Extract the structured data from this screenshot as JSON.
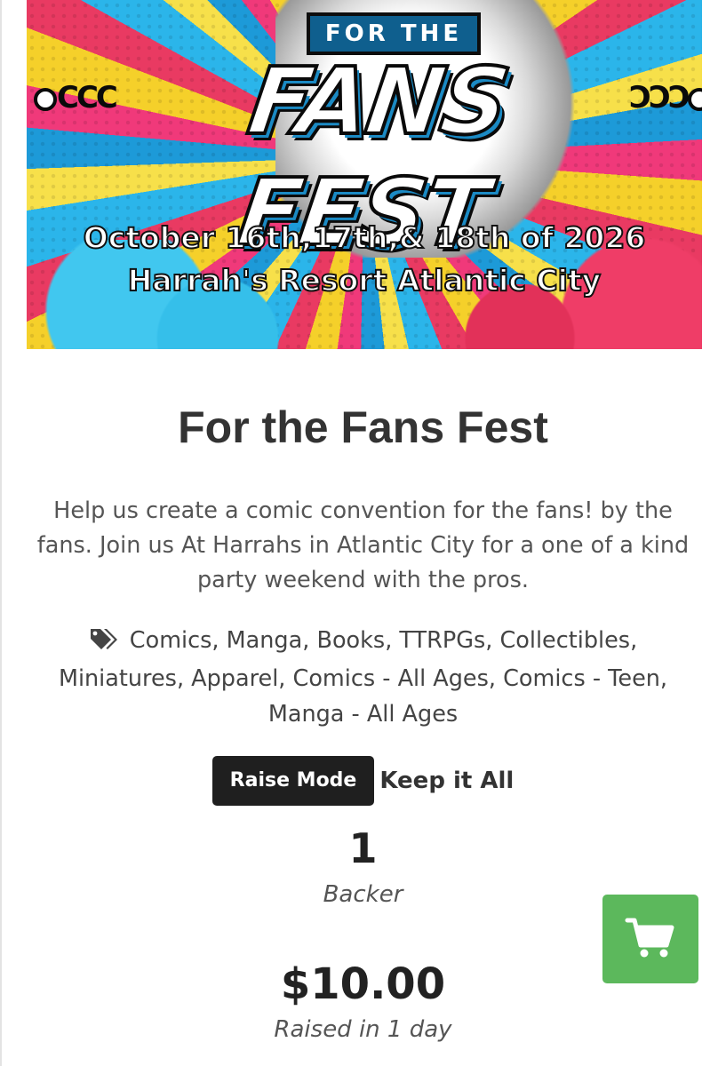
{
  "banner": {
    "top_text": "FOR THE",
    "main_text": "FANS FEST",
    "dates": "October 16th,17th,& 18th of 2026",
    "venue": "Harrah's Resort Atlantic City",
    "ornament_left": "CCC",
    "ornament_right": "ƆƆƆ"
  },
  "campaign": {
    "title": "For the Fans Fest",
    "description": "Help us create a comic convention for the fans! by the fans. Join us At Harrahs in Atlantic City for a one of a kind party weekend with the pros.",
    "tags": "Comics, Manga, Books, TTRPGs, Collectibles, Miniatures, Apparel, Comics - All Ages, Comics - Teen, Manga - All Ages",
    "tag_icon": "tags-icon"
  },
  "raise_mode": {
    "button_label": "Raise Mode",
    "value": "Keep it All"
  },
  "stats": {
    "backers_count": "1",
    "backers_label": "Backer",
    "raised_amount": "$10.00",
    "raised_label": "Raised in 1 day"
  },
  "cart": {
    "icon": "shopping-cart-icon"
  },
  "colors": {
    "cart_button": "#5cb85c",
    "raise_button": "#1f1f1f"
  }
}
